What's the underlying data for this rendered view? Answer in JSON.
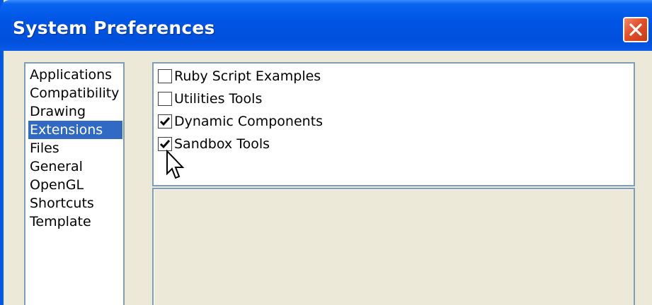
{
  "window": {
    "title": "System Preferences"
  },
  "categories": [
    {
      "label": "Applications",
      "selected": false
    },
    {
      "label": "Compatibility",
      "selected": false
    },
    {
      "label": "Drawing",
      "selected": false
    },
    {
      "label": "Extensions",
      "selected": true
    },
    {
      "label": "Files",
      "selected": false
    },
    {
      "label": "General",
      "selected": false
    },
    {
      "label": "OpenGL",
      "selected": false
    },
    {
      "label": "Shortcuts",
      "selected": false
    },
    {
      "label": "Template",
      "selected": false
    }
  ],
  "extensions": [
    {
      "label": "Ruby Script Examples",
      "checked": false
    },
    {
      "label": "Utilities Tools",
      "checked": false
    },
    {
      "label": "Dynamic Components",
      "checked": true
    },
    {
      "label": "Sandbox Tools",
      "checked": true
    }
  ],
  "icons": {
    "close": "close-icon",
    "cursor": "mouse-pointer-icon",
    "check": "checkmark-icon"
  },
  "colors": {
    "titlebar": "#0055e5",
    "selection": "#316ac5",
    "dialog_bg": "#ece9d8",
    "close": "#e2502a"
  }
}
